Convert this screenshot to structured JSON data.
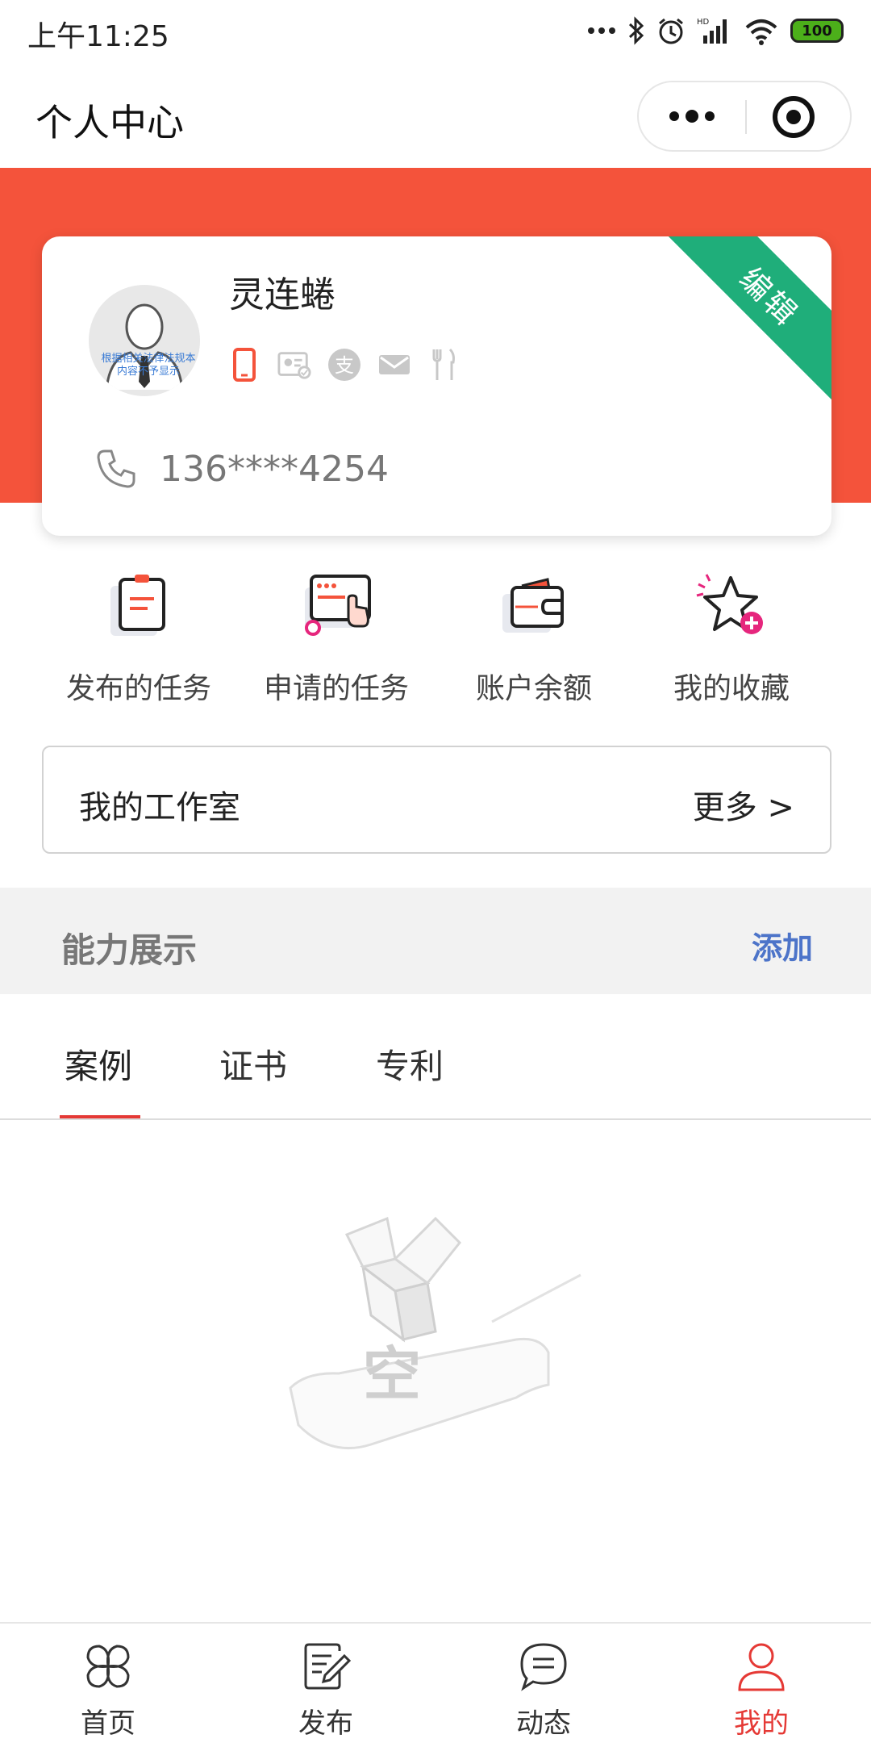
{
  "status_bar": {
    "time": "上午11:25",
    "battery": "100"
  },
  "nav": {
    "title": "个人中心"
  },
  "profile": {
    "name": "灵连蜷",
    "phone": "136****4254",
    "edit_label": "编辑",
    "avatar_watermark": "根据相关法律法规本内容不予显示"
  },
  "quick_actions": [
    {
      "label": "发布的任务"
    },
    {
      "label": "申请的任务"
    },
    {
      "label": "账户余额"
    },
    {
      "label": "我的收藏"
    }
  ],
  "studio": {
    "title": "我的工作室",
    "more": "更多 >"
  },
  "ability": {
    "title": "能力展示",
    "add": "添加"
  },
  "tabs": [
    "案例",
    "证书",
    "专利"
  ],
  "empty": {
    "text": "空"
  },
  "tab_bar": [
    {
      "label": "首页"
    },
    {
      "label": "发布"
    },
    {
      "label": "动态"
    },
    {
      "label": "我的",
      "active": true
    }
  ],
  "colors": {
    "brand_red": "#f4533b",
    "edit_green": "#1fae7a",
    "link_blue": "#4d74c9",
    "active_red": "#e53935"
  }
}
